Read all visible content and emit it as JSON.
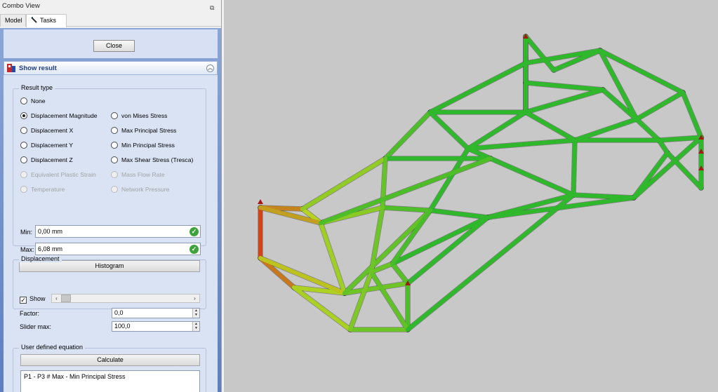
{
  "window": {
    "title": "Combo View",
    "float_icon": "dock-float-icon"
  },
  "tabs": [
    {
      "label": "Model",
      "active": false
    },
    {
      "label": "Tasks",
      "active": true,
      "icon": "tasks-icon"
    }
  ],
  "close_button": "Close",
  "panel": {
    "title": "Show result",
    "icon": "fem-result-icon",
    "collapse_icon": "collapse-icon"
  },
  "result_type": {
    "title": "Result type",
    "left_options": [
      {
        "label": "None",
        "checked": false,
        "enabled": true
      },
      {
        "label": "Displacement Magnitude",
        "checked": true,
        "enabled": true
      },
      {
        "label": "Displacement X",
        "checked": false,
        "enabled": true
      },
      {
        "label": "Displacement Y",
        "checked": false,
        "enabled": true
      },
      {
        "label": "Displacement Z",
        "checked": false,
        "enabled": true
      },
      {
        "label": "Equivalent Plastic Strain",
        "checked": false,
        "enabled": false
      },
      {
        "label": "Temperature",
        "checked": false,
        "enabled": false
      }
    ],
    "right_options": [
      {
        "label": "von Mises Stress",
        "checked": false,
        "enabled": true
      },
      {
        "label": "Max Principal Stress",
        "checked": false,
        "enabled": true
      },
      {
        "label": "Min Principal Stress",
        "checked": false,
        "enabled": true
      },
      {
        "label": "Max Shear Stress (Tresca)",
        "checked": false,
        "enabled": true
      },
      {
        "label": "Mass Flow Rate",
        "checked": false,
        "enabled": false
      },
      {
        "label": "Network Pressure",
        "checked": false,
        "enabled": false
      }
    ],
    "min_label": "Min:",
    "min_value": "0,00 mm",
    "max_label": "Max:",
    "max_value": "6,08 mm",
    "histogram_button": "Histogram"
  },
  "displacement": {
    "title": "Displacement",
    "show_label": "Show",
    "show_checked": true,
    "slider_level": 0,
    "factor_label": "Factor:",
    "factor_value": "0,0",
    "slider_max_label": "Slider max:",
    "slider_max_value": "100,0"
  },
  "equation": {
    "title": "User defined equation",
    "calculate_button": "Calculate",
    "text": "P1 - P3 # Max - Min Principal Stress"
  },
  "viewport": {
    "background": "#c8c8c8",
    "colors": {
      "low": "#2fb82b",
      "mid": "#b9d420",
      "high": "#d1401b",
      "max": "#a61818"
    }
  }
}
